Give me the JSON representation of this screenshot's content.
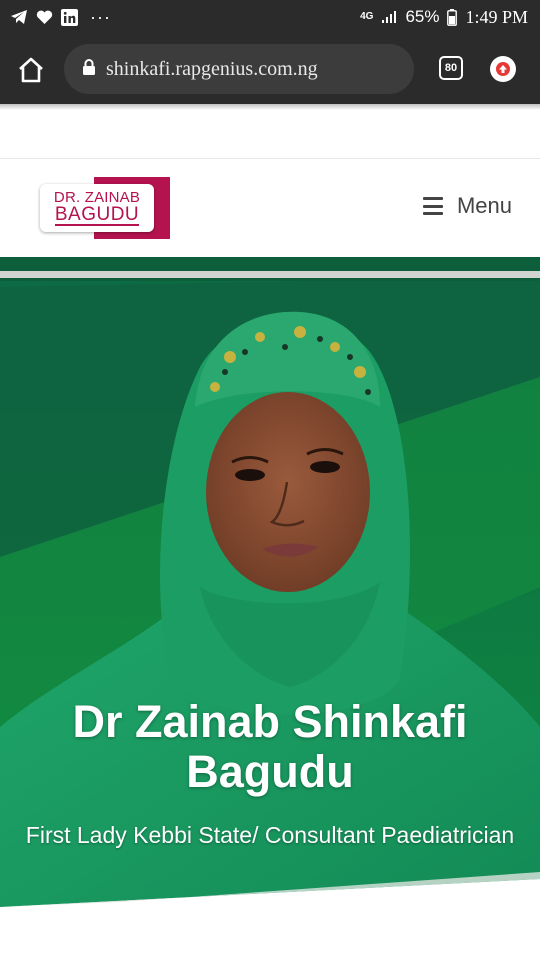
{
  "status_bar": {
    "battery": "65%",
    "time": "1:49 PM",
    "network": "4G",
    "notification_icons": [
      "telegram-icon",
      "heart-icon",
      "linkedin-icon",
      "more-dots-icon"
    ]
  },
  "browser": {
    "url": "shinkafi.rapgenius.com.ng",
    "tab_count": "80"
  },
  "site": {
    "logo_line1": "DR. ZAINAB",
    "logo_line2": "BAGUDU",
    "menu_label": "Menu"
  },
  "hero": {
    "title": "Dr Zainab Shinkafi Bagudu",
    "subtitle": "First Lady Kebbi State/ Consultant Paediatrician"
  },
  "colors": {
    "brand": "#b5134f",
    "hero_green": "#0f7a45",
    "chrome_dark": "#2b2b2b"
  }
}
